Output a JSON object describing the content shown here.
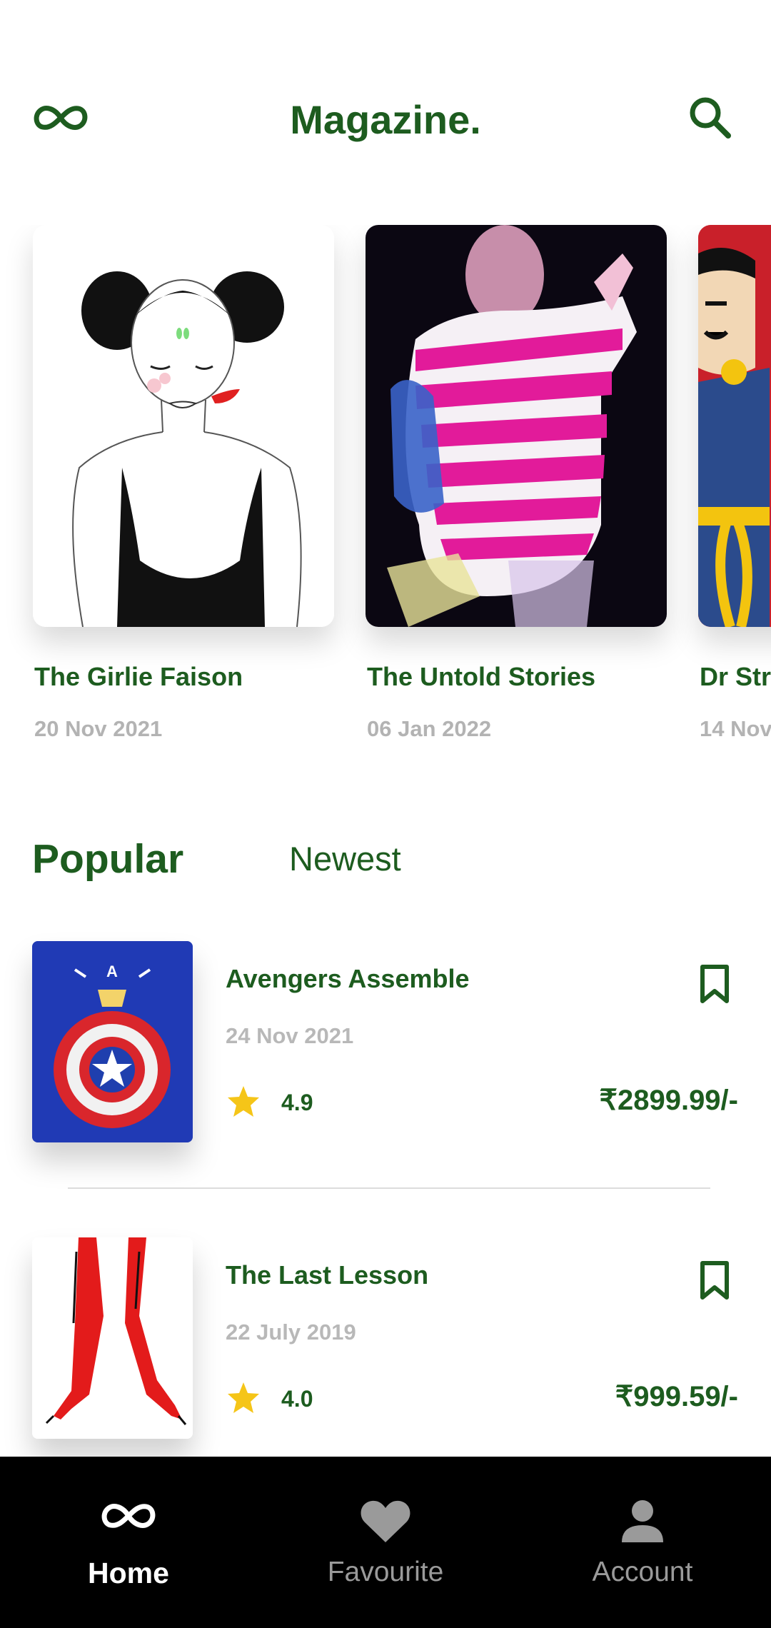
{
  "header": {
    "title": "Magazine.",
    "logo_icon": "infinity-icon",
    "search_icon": "search-icon"
  },
  "featured": [
    {
      "title": "The Girlie Faison",
      "date": "20 Nov 2021"
    },
    {
      "title": "The Untold Stories",
      "date": "06 Jan 2022"
    },
    {
      "title": "Dr Str",
      "date": "14 Nov"
    }
  ],
  "tabs": {
    "popular": "Popular",
    "newest": "Newest",
    "active": "popular"
  },
  "list": [
    {
      "title": "Avengers Assemble",
      "date": "24 Nov 2021",
      "rating": "4.9",
      "price": "₹2899.99/-"
    },
    {
      "title": "The Last Lesson",
      "date": "22 July 2019",
      "rating": "4.0",
      "price": "₹999.59/-"
    }
  ],
  "nav": {
    "home": "Home",
    "favourite": "Favourite",
    "account": "Account",
    "active": "home"
  },
  "colors": {
    "brand_green": "#1d5c1f",
    "star": "#f5c518",
    "nav_bg": "#000000"
  }
}
